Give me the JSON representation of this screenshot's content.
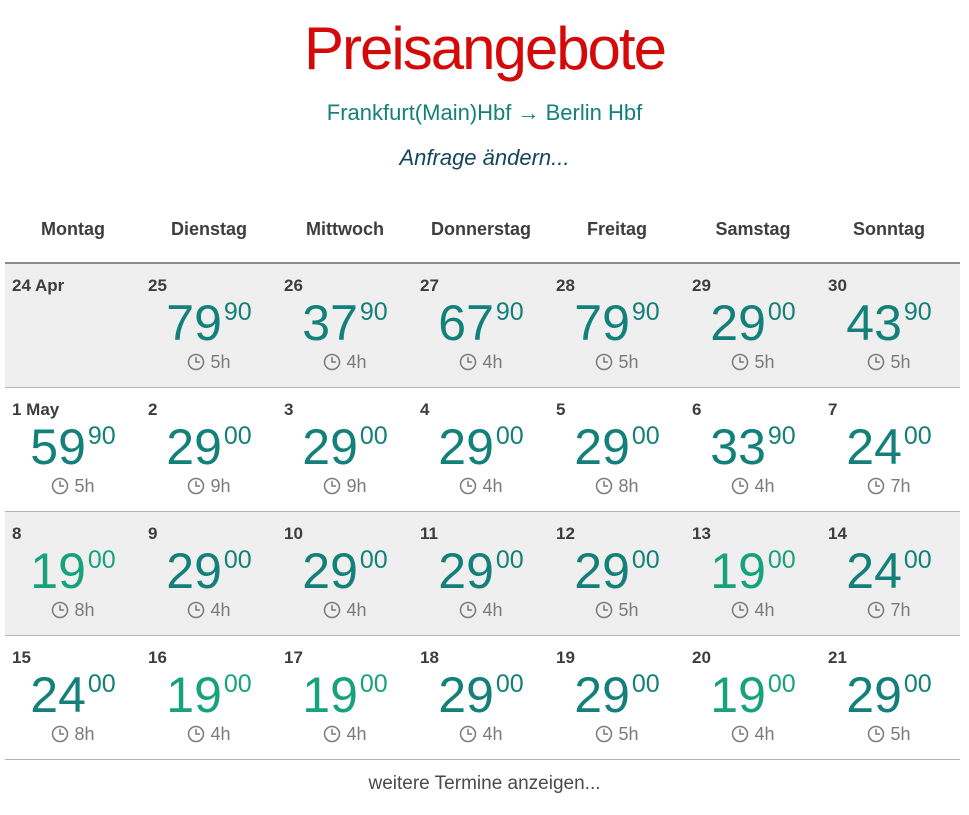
{
  "header": {
    "title": "Preisangebote",
    "route": "Frankfurt(Main)Hbf → Berlin Hbf",
    "change_link": "Anfrage ändern..."
  },
  "weekdays": [
    "Montag",
    "Dienstag",
    "Mittwoch",
    "Donnerstag",
    "Freitag",
    "Samstag",
    "Sonntag"
  ],
  "weeks": [
    [
      {
        "date": "24 Apr"
      },
      {
        "date": "25",
        "euro": "79",
        "cent": "90",
        "duration": "5h"
      },
      {
        "date": "26",
        "euro": "37",
        "cent": "90",
        "duration": "4h"
      },
      {
        "date": "27",
        "euro": "67",
        "cent": "90",
        "duration": "4h"
      },
      {
        "date": "28",
        "euro": "79",
        "cent": "90",
        "duration": "5h"
      },
      {
        "date": "29",
        "euro": "29",
        "cent": "00",
        "duration": "5h"
      },
      {
        "date": "30",
        "euro": "43",
        "cent": "90",
        "duration": "5h"
      }
    ],
    [
      {
        "date": "1 May",
        "euro": "59",
        "cent": "90",
        "duration": "5h"
      },
      {
        "date": "2",
        "euro": "29",
        "cent": "00",
        "duration": "9h"
      },
      {
        "date": "3",
        "euro": "29",
        "cent": "00",
        "duration": "9h"
      },
      {
        "date": "4",
        "euro": "29",
        "cent": "00",
        "duration": "4h"
      },
      {
        "date": "5",
        "euro": "29",
        "cent": "00",
        "duration": "8h"
      },
      {
        "date": "6",
        "euro": "33",
        "cent": "90",
        "duration": "4h"
      },
      {
        "date": "7",
        "euro": "24",
        "cent": "00",
        "duration": "7h"
      }
    ],
    [
      {
        "date": "8",
        "euro": "19",
        "cent": "00",
        "duration": "8h",
        "cheapest": true
      },
      {
        "date": "9",
        "euro": "29",
        "cent": "00",
        "duration": "4h"
      },
      {
        "date": "10",
        "euro": "29",
        "cent": "00",
        "duration": "4h"
      },
      {
        "date": "11",
        "euro": "29",
        "cent": "00",
        "duration": "4h"
      },
      {
        "date": "12",
        "euro": "29",
        "cent": "00",
        "duration": "5h"
      },
      {
        "date": "13",
        "euro": "19",
        "cent": "00",
        "duration": "4h",
        "cheapest": true
      },
      {
        "date": "14",
        "euro": "24",
        "cent": "00",
        "duration": "7h"
      }
    ],
    [
      {
        "date": "15",
        "euro": "24",
        "cent": "00",
        "duration": "8h"
      },
      {
        "date": "16",
        "euro": "19",
        "cent": "00",
        "duration": "4h",
        "cheapest": true
      },
      {
        "date": "17",
        "euro": "19",
        "cent": "00",
        "duration": "4h",
        "cheapest": true
      },
      {
        "date": "18",
        "euro": "29",
        "cent": "00",
        "duration": "4h"
      },
      {
        "date": "19",
        "euro": "29",
        "cent": "00",
        "duration": "5h"
      },
      {
        "date": "20",
        "euro": "19",
        "cent": "00",
        "duration": "4h",
        "cheapest": true
      },
      {
        "date": "21",
        "euro": "29",
        "cent": "00",
        "duration": "5h"
      }
    ]
  ],
  "footer": {
    "more_link": "weitere Termine anzeigen..."
  },
  "colors": {
    "title": "#d40a0a",
    "route": "#138079",
    "price": "#138079",
    "price_cheapest": "#16a37c",
    "row_shade": "#efefef"
  },
  "icons": {
    "duration": "clock-icon"
  }
}
